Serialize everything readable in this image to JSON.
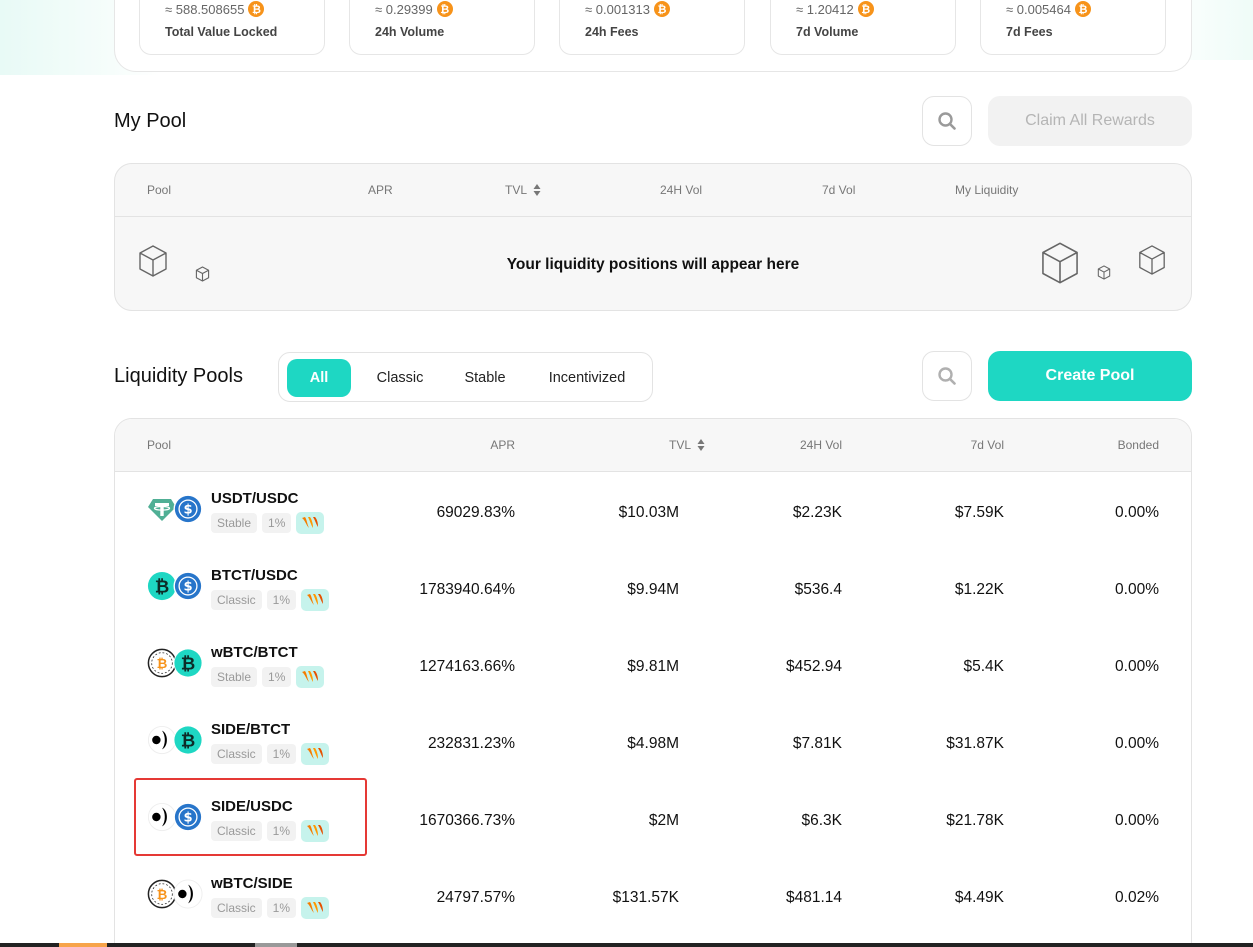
{
  "stats": [
    {
      "value": "≈ 588.508655",
      "label": "Total Value Locked"
    },
    {
      "value": "≈ 0.29399",
      "label": "24h Volume"
    },
    {
      "value": "≈ 0.001313",
      "label": "24h Fees"
    },
    {
      "value": "≈ 1.20412",
      "label": "7d Volume"
    },
    {
      "value": "≈ 0.005464",
      "label": "7d Fees"
    }
  ],
  "btc_symbol": "₿",
  "my_pool": {
    "title": "My Pool",
    "claim_label": "Claim All Rewards",
    "columns": [
      "Pool",
      "APR",
      "TVL",
      "24H Vol",
      "7d Vol",
      "My Liquidity"
    ],
    "empty_message": "Your liquidity positions will appear here"
  },
  "liquidity_pools": {
    "title": "Liquidity Pools",
    "tabs": [
      "All",
      "Classic",
      "Stable",
      "Incentivized"
    ],
    "active_tab": "All",
    "create_label": "Create Pool",
    "columns": [
      "Pool",
      "APR",
      "TVL",
      "24H Vol",
      "7d Vol",
      "Bonded"
    ],
    "rows": [
      {
        "pair": "USDT/USDC",
        "type": "Stable",
        "fee": "1%",
        "apr": "69029.83%",
        "tvl": "$10.03M",
        "vol24": "$2.23K",
        "vol7": "$7.59K",
        "bonded": "0.00%"
      },
      {
        "pair": "BTCT/USDC",
        "type": "Classic",
        "fee": "1%",
        "apr": "1783940.64%",
        "tvl": "$9.94M",
        "vol24": "$536.4",
        "vol7": "$1.22K",
        "bonded": "0.00%"
      },
      {
        "pair": "wBTC/BTCT",
        "type": "Stable",
        "fee": "1%",
        "apr": "1274163.66%",
        "tvl": "$9.81M",
        "vol24": "$452.94",
        "vol7": "$5.4K",
        "bonded": "0.00%"
      },
      {
        "pair": "SIDE/BTCT",
        "type": "Classic",
        "fee": "1%",
        "apr": "232831.23%",
        "tvl": "$4.98M",
        "vol24": "$7.81K",
        "vol7": "$31.87K",
        "bonded": "0.00%"
      },
      {
        "pair": "SIDE/USDC",
        "type": "Classic",
        "fee": "1%",
        "apr": "1670366.73%",
        "tvl": "$2M",
        "vol24": "$6.3K",
        "vol7": "$21.78K",
        "bonded": "0.00%"
      },
      {
        "pair": "wBTC/SIDE",
        "type": "Classic",
        "fee": "1%",
        "apr": "24797.57%",
        "tvl": "$131.57K",
        "vol24": "$481.14",
        "vol7": "$4.49K",
        "bonded": "0.02%"
      }
    ]
  },
  "colors": {
    "accent": "#1ed7c3",
    "highlight": "#e53935",
    "usdt": "#50af95",
    "usdc": "#2775ca",
    "btct": "#1ed7c3",
    "btc": "#f7931a"
  }
}
